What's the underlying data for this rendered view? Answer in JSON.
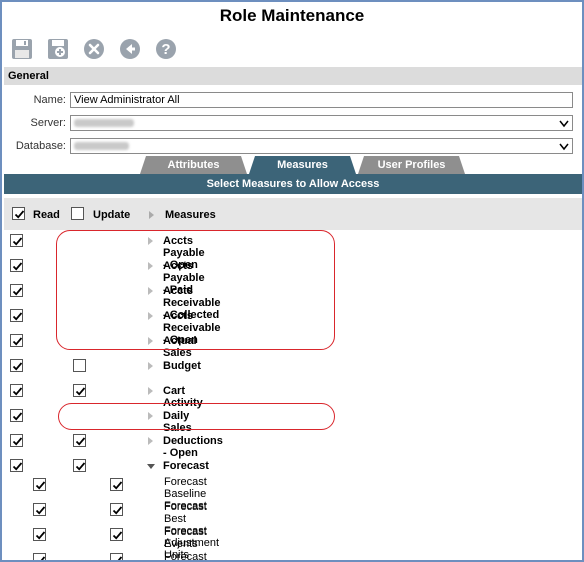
{
  "title": "Role Maintenance",
  "toolbar": {
    "icons": [
      "save-icon",
      "save-as-icon",
      "delete-icon",
      "back-icon",
      "help-icon"
    ]
  },
  "general": {
    "section_label": "General",
    "name_label": "Name:",
    "name_value": "View Administrator All",
    "server_label": "Server:",
    "database_label": "Database:"
  },
  "tabs": [
    {
      "label": "Attributes",
      "active": false
    },
    {
      "label": "Measures",
      "active": true
    },
    {
      "label": "User Profiles",
      "active": false
    }
  ],
  "measures_panel": {
    "header": "Select Measures to Allow Access",
    "col_read": "Read",
    "col_update": "Update",
    "col_measures": "Measures",
    "read_all_checked": true,
    "update_all_checked": false
  },
  "rows": [
    {
      "label": "Accts Payable - Open",
      "read": true,
      "update": null,
      "expanded": false
    },
    {
      "label": "Accts Payable - Paid",
      "read": true,
      "update": null,
      "expanded": false
    },
    {
      "label": "Accts Receivable - Collected",
      "read": true,
      "update": null,
      "expanded": false
    },
    {
      "label": "Accts Receivable - Open",
      "read": true,
      "update": null,
      "expanded": false
    },
    {
      "label": "Actual Sales",
      "read": true,
      "update": null,
      "expanded": false
    },
    {
      "label": "Budget",
      "read": true,
      "update": false,
      "expanded": false
    },
    {
      "label": "Cart Activity",
      "read": true,
      "update": true,
      "expanded": false
    },
    {
      "label": "Daily Sales",
      "read": true,
      "update": null,
      "expanded": false
    },
    {
      "label": "Deductions - Open",
      "read": true,
      "update": true,
      "expanded": false
    },
    {
      "label": "Forecast",
      "read": true,
      "update": true,
      "expanded": true
    }
  ],
  "sub_rows": [
    {
      "label": "Forecast Baseline Forecast",
      "read": true,
      "update": true
    },
    {
      "label": "Forecast Best Forecast Adjustment Units",
      "read": true,
      "update": true
    },
    {
      "label": "Forecast Events",
      "read": true,
      "update": true
    },
    {
      "label": "Forecast Fitted Values",
      "read": true,
      "update": true
    }
  ],
  "colors": {
    "accent": "#3c6478",
    "highlight": "#d9262c",
    "frame": "#6d8fbf"
  }
}
